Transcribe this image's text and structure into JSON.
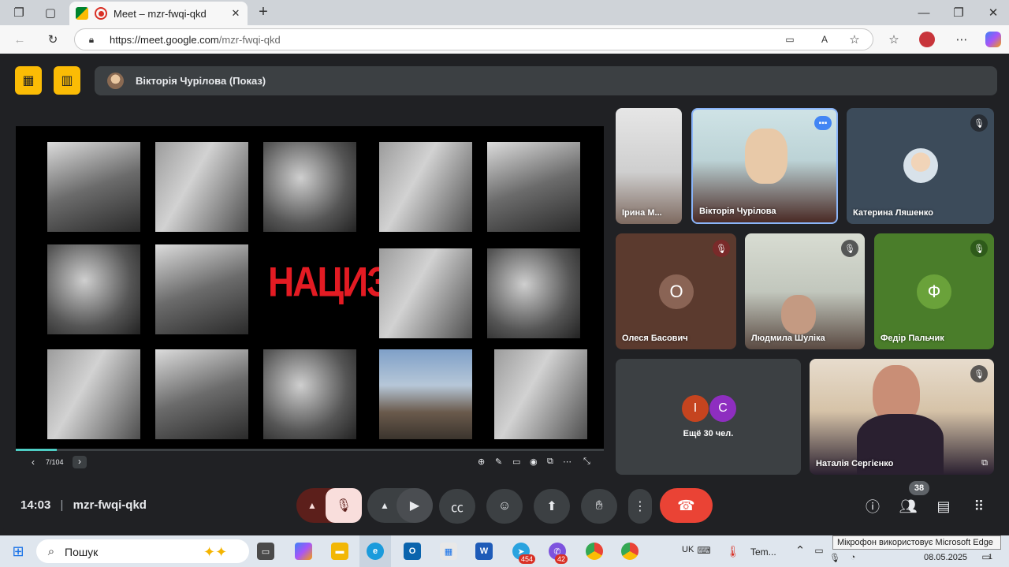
{
  "browser": {
    "tab_title": "Meet – mzr-fwqi-qkd",
    "url": "https://meet.google.com/mzr-fwqi-qkd",
    "url_host": "https://meet.google.com",
    "url_path": "/mzr-fwqi-qkd"
  },
  "meet": {
    "presenter_label": "Вікторія Чурілова (Показ)",
    "slide": {
      "title": "НАЦИЗМ",
      "page_indicator": "7/104",
      "progress": 0.07
    },
    "participants": [
      {
        "name": "Ірина М...",
        "muted": false
      },
      {
        "name": "Вікторія Чурілова",
        "muted": false,
        "speaking": true
      },
      {
        "name": "Катерина Ляшенко",
        "muted": true
      },
      {
        "name": "Олеся Басович",
        "initial": "О",
        "muted": true,
        "color": "#5b3a2e"
      },
      {
        "name": "Людмила Шуліка",
        "muted": true
      },
      {
        "name": "Федір Пальчик",
        "initial": "Ф",
        "muted": true,
        "color": "#4a7d2a"
      },
      {
        "name": "Наталія Сергієнко",
        "muted": true
      }
    ],
    "more_people": {
      "label": "Ещё 30 чел.",
      "avatars": [
        {
          "initial": "I",
          "color": "#c5441f"
        },
        {
          "initial": "C",
          "color": "#8e2ec0"
        }
      ]
    },
    "footer": {
      "time": "14:03",
      "meeting_code": "mzr-fwqi-qkd",
      "participant_count": "38"
    }
  },
  "taskbar": {
    "search_placeholder": "Пошук",
    "language": "UK",
    "weather": "Tem...",
    "date": "08.05.2025",
    "badge_telegram": "454",
    "badge_viber": "42",
    "notification_count": "1"
  },
  "tooltip": "Мікрофон використовує Microsoft Edge",
  "colors": {
    "meet_bg": "#202124",
    "accent_yellow": "#fbbc05",
    "end_call_red": "#ea4335",
    "mic_muted_bg": "#f9dedc",
    "slide_title_red": "#e31b23"
  }
}
